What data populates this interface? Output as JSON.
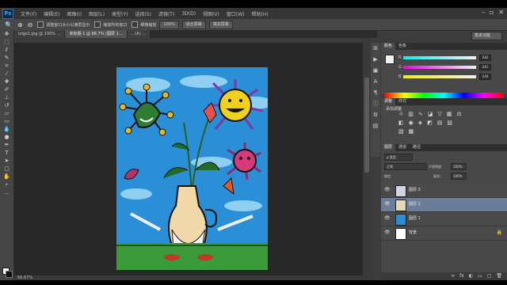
{
  "menu": {
    "logo": "Ps",
    "items": [
      "文件(F)",
      "编辑(E)",
      "图像(I)",
      "图层(L)",
      "类型(Y)",
      "选择(S)",
      "滤镜(T)",
      "3D(D)",
      "视图(V)",
      "窗口(W)",
      "帮助(H)"
    ]
  },
  "options": {
    "btn1": "100%",
    "check1_label": "调整窗口大小以满屏显示",
    "check2_label": "缩放所有窗口",
    "check3_label": "细微缩放",
    "btn2": "100%",
    "btn3": "适合屏幕",
    "btn4": "填充屏幕",
    "workspace": "基本功能"
  },
  "tabs": [
    "lolgo1.jpg @ 100% ...",
    "未标题-1 @ 66.7% (图层 1...",
    "...(A) ..."
  ],
  "status": "66.67%",
  "panels": {
    "color_tabs": [
      "颜色",
      "色板"
    ],
    "values": {
      "R": "242",
      "G": "241",
      "B": "240"
    },
    "adj_tabs": [
      "调整",
      "样式"
    ],
    "adj_title": "添加调整",
    "layer_tabs": [
      "图层",
      "通道",
      "路径"
    ],
    "kind": "ρ 类型",
    "blend": "正常",
    "opacity_label": "不透明度:",
    "opacity": "100%",
    "fill_label": "填充:",
    "fill": "100%",
    "lock_label": "锁定:"
  },
  "layers": [
    {
      "name": "图层 3",
      "selected": false
    },
    {
      "name": "图层 2",
      "selected": true
    },
    {
      "name": "图层 1",
      "selected": false
    },
    {
      "name": "背景",
      "selected": false
    }
  ],
  "tool_icons": [
    "move-icon",
    "marquee-icon",
    "lasso-icon",
    "quick-select-icon",
    "crop-icon",
    "eyedropper-icon",
    "healing-icon",
    "brush-icon",
    "stamp-icon",
    "history-brush-icon",
    "eraser-icon",
    "gradient-icon",
    "blur-icon",
    "dodge-icon",
    "pen-icon",
    "type-icon",
    "path-select-icon",
    "shape-icon",
    "hand-icon",
    "zoom-icon"
  ]
}
